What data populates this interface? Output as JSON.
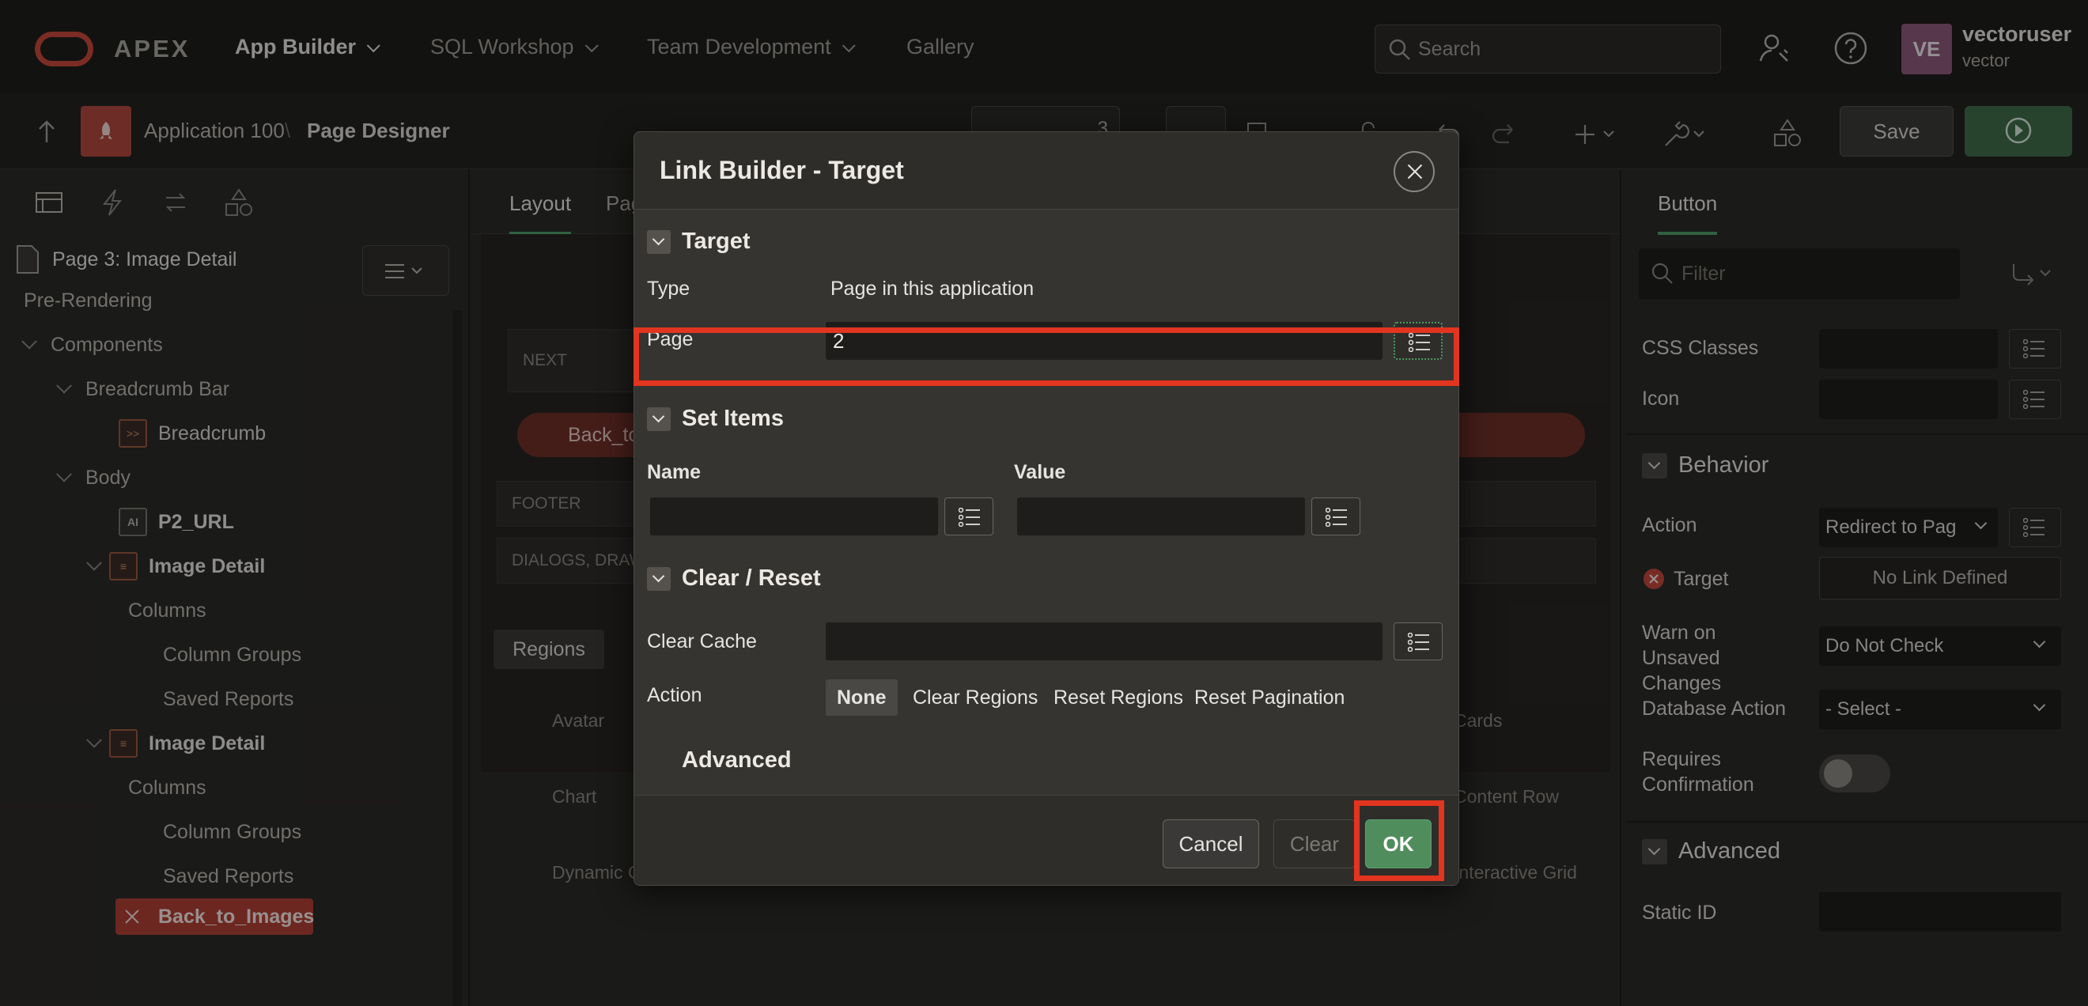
{
  "topbar": {
    "brand": "APEX",
    "nav": [
      {
        "label": "App Builder",
        "active": true,
        "has_menu": true
      },
      {
        "label": "SQL Workshop",
        "active": false,
        "has_menu": true
      },
      {
        "label": "Team Development",
        "active": false,
        "has_menu": true
      },
      {
        "label": "Gallery",
        "active": false,
        "has_menu": false
      }
    ],
    "search_placeholder": "Search",
    "user": {
      "initials": "VE",
      "name": "vectoruser",
      "workspace": "vector"
    }
  },
  "toolbar": {
    "application": "Application 100",
    "separator": "\\",
    "page_designer": "Page Designer",
    "page_number": "3",
    "save_label": "Save"
  },
  "left_panel": {
    "page_title": "Page 3: Image Detail",
    "tree": [
      {
        "label": "Pre-Rendering",
        "level": 0
      },
      {
        "label": "Components",
        "level": 0
      },
      {
        "label": "Breadcrumb Bar",
        "level": 1
      },
      {
        "label": "Breadcrumb",
        "level": 2
      },
      {
        "label": "Body",
        "level": 1
      },
      {
        "label": "P2_URL",
        "level": 2
      },
      {
        "label": "Image Detail",
        "level": 2
      },
      {
        "label": "Columns",
        "level": 3
      },
      {
        "label": "Column Groups",
        "level": 3
      },
      {
        "label": "Saved Reports",
        "level": 3
      },
      {
        "label": "Image Detail",
        "level": 2
      },
      {
        "label": "Columns",
        "level": 3
      },
      {
        "label": "Column Groups",
        "level": 3
      },
      {
        "label": "Saved Reports",
        "level": 3
      },
      {
        "label": "Back_to_Images",
        "level": 2,
        "selected": true
      }
    ]
  },
  "center_panel": {
    "tabs": [
      "Layout",
      "Pag"
    ],
    "layout_labels": {
      "next": "NEXT",
      "button": "Back_to_",
      "footer": "FOOTER",
      "dialogs": "DIALOGS, DRAWE"
    },
    "gallery_tab": "Regions",
    "gallery_items": [
      "Avatar",
      "Chart",
      "Dynamic C",
      "Interactive",
      "Cards",
      "Content Row",
      "Interactive Grid"
    ]
  },
  "right_panel": {
    "tab": "Button",
    "filter_placeholder": "Filter",
    "css_classes_label": "CSS Classes",
    "icon_label": "Icon",
    "behavior_title": "Behavior",
    "action_label": "Action",
    "action_value": "Redirect to Pag",
    "target_label": "Target",
    "target_value": "No Link Defined",
    "warn_label": "Warn on Unsaved Changes",
    "warn_value": "Do Not Check",
    "db_action_label": "Database Action",
    "db_action_value": "- Select -",
    "requires_label": "Requires Confirmation",
    "advanced_title": "Advanced",
    "static_id_label": "Static ID"
  },
  "dialog": {
    "title": "Link Builder - Target",
    "target_section": "Target",
    "type_label": "Type",
    "type_value": "Page in this application",
    "page_label": "Page",
    "page_value": "2",
    "set_items_section": "Set Items",
    "name_label": "Name",
    "value_label": "Value",
    "clear_reset_section": "Clear / Reset",
    "clear_cache_label": "Clear Cache",
    "action_label": "Action",
    "action_options": [
      "None",
      "Clear Regions",
      "Reset Regions",
      "Reset Pagination"
    ],
    "action_selected": "None",
    "advanced_section": "Advanced",
    "cancel_label": "Cancel",
    "clear_label": "Clear",
    "ok_label": "OK"
  }
}
